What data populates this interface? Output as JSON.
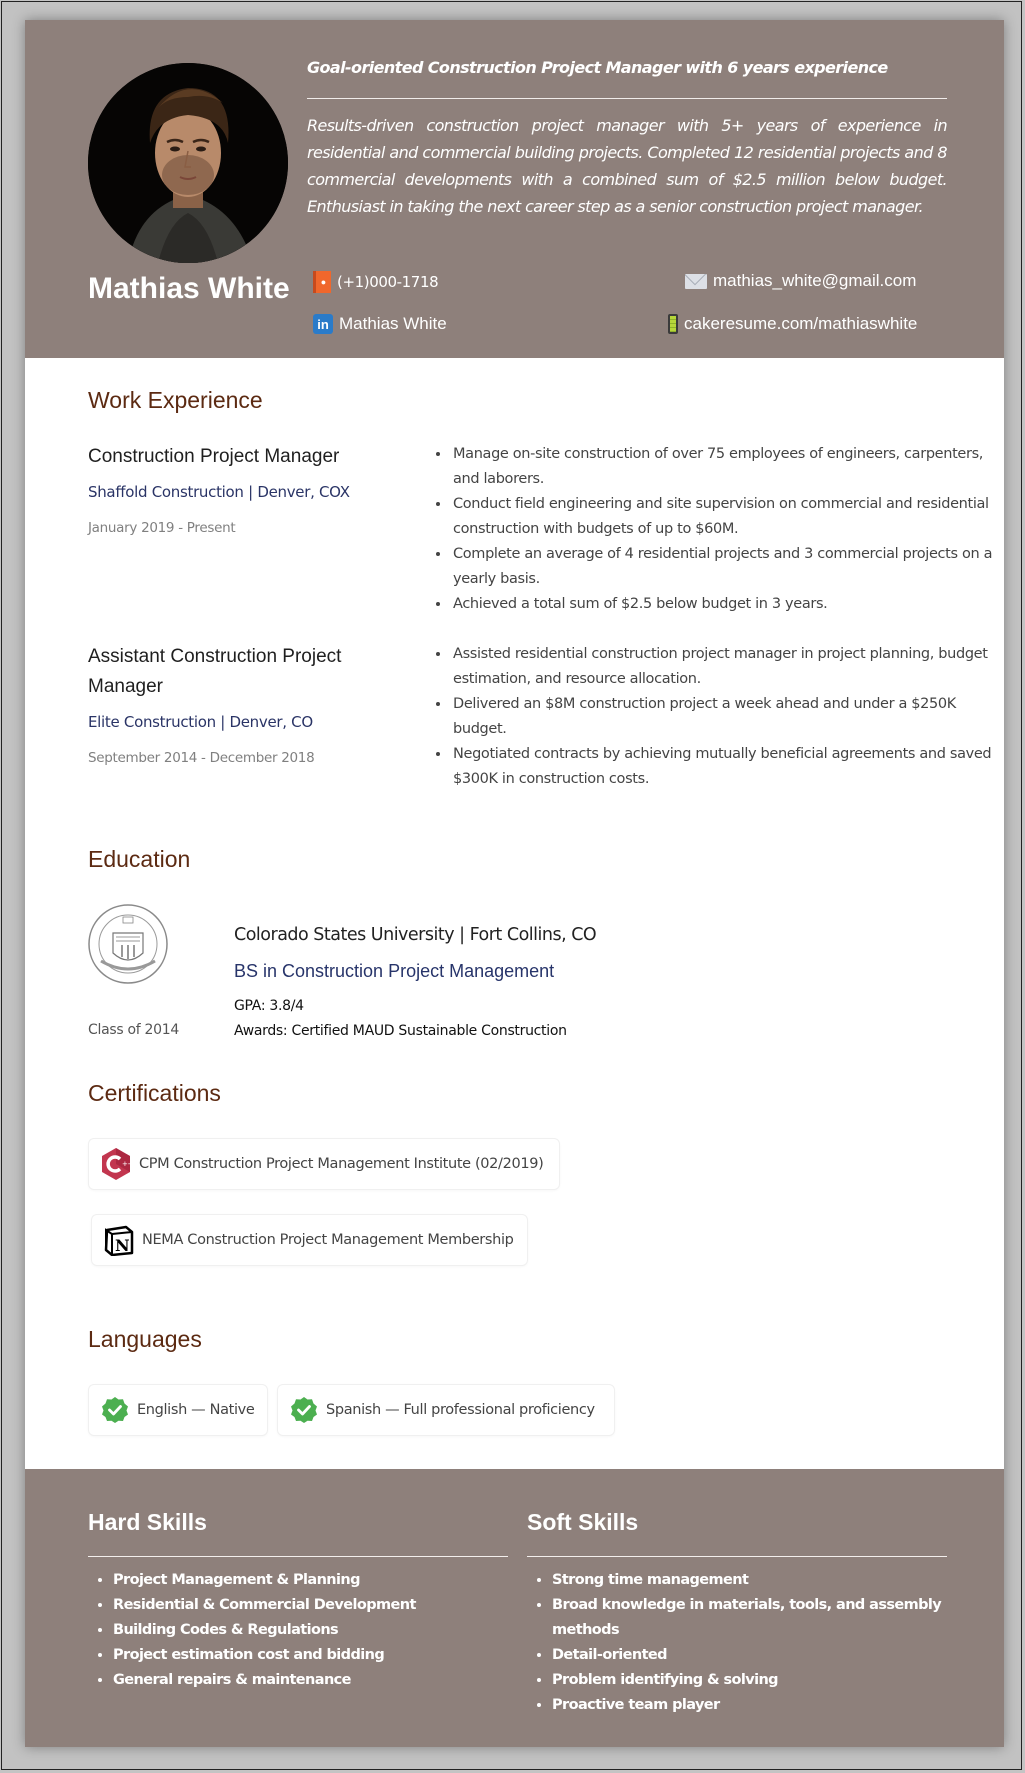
{
  "header": {
    "name": "Mathias White",
    "headline": "Goal-oriented Construction Project Manager with 6 years experience",
    "summary": "Results-driven construction project manager with 5+ years of experience in residential and commercial building projects. Completed 12 residential projects and 8 commercial developments with a combined sum of $2.5 million below budget. Enthusiast in taking the next career step as a senior construction project manager.",
    "contacts": {
      "phone": {
        "icon": "phone-book-icon",
        "value": "(+1)000-1718"
      },
      "email": {
        "icon": "envelope-icon",
        "value": "mathias_white@gmail.com"
      },
      "linkedin": {
        "icon": "linkedin-icon",
        "value": "Mathias White"
      },
      "website": {
        "icon": "battery-icon",
        "value": "cakeresume.com/mathiaswhite"
      }
    }
  },
  "work": {
    "title": "Work Experience",
    "jobs": [
      {
        "title": "Construction Project Manager",
        "company": "Shaffold Construction | Denver, COX",
        "dates": "January 2019 - Present",
        "bullets": [
          "Manage on-site construction of over 75 employees of engineers, carpenters, and laborers.",
          "Conduct field engineering and site supervision on commercial and residential construction with budgets of up to $60M.",
          "Complete an average of 4 residential projects and 3 commercial projects on a yearly basis.",
          "Achieved a total sum of $2.5 below budget in 3 years."
        ]
      },
      {
        "title": "Assistant Construction Project Manager",
        "company": "Elite Construction | Denver, CO",
        "dates": "September 2014 - December 2018",
        "bullets": [
          "Assisted residential construction project manager in project planning, budget estimation, and resource allocation.",
          "Delivered an $8M construction project a week ahead and under a $250K budget.",
          "Negotiated contracts by achieving mutually beneficial agreements and saved $300K in construction costs."
        ]
      }
    ]
  },
  "education": {
    "title": "Education",
    "class": "Class of 2014",
    "school": "Colorado States University | Fort Collins, CO",
    "degree": "BS in Construction Project Management",
    "gpa": "GPA: 3.8/4",
    "awards": "Awards: Certified MAUD Sustainable Construction"
  },
  "certifications": {
    "title": "Certifications",
    "items": [
      {
        "icon": "cpp-hexagon-icon",
        "label": "CPM Construction Project Management Institute (02/2019)"
      },
      {
        "icon": "notion-icon",
        "label": "NEMA Construction Project Management Membership"
      }
    ]
  },
  "languages": {
    "title": "Languages",
    "items": [
      {
        "icon": "verified-check-icon",
        "label": "English — Native"
      },
      {
        "icon": "verified-check-icon",
        "label": "Spanish —  Full professional proficiency"
      }
    ]
  },
  "skills": {
    "hard": {
      "title": "Hard Skills",
      "items": [
        "Project Management & Planning",
        "Residential & Commercial Development",
        "Building Codes & Regulations",
        "Project estimation cost and bidding",
        "General repairs & maintenance"
      ]
    },
    "soft": {
      "title": "Soft Skills",
      "items": [
        "Strong time management",
        "Broad knowledge in materials, tools, and assembly methods",
        "Detail-oriented",
        "Problem identifying & solving",
        "Proactive team player"
      ]
    }
  },
  "colors": {
    "header_bg": "#8e807b",
    "section_title": "#5c2a12",
    "company_text": "#2a3466",
    "check_green": "#4caf50"
  }
}
